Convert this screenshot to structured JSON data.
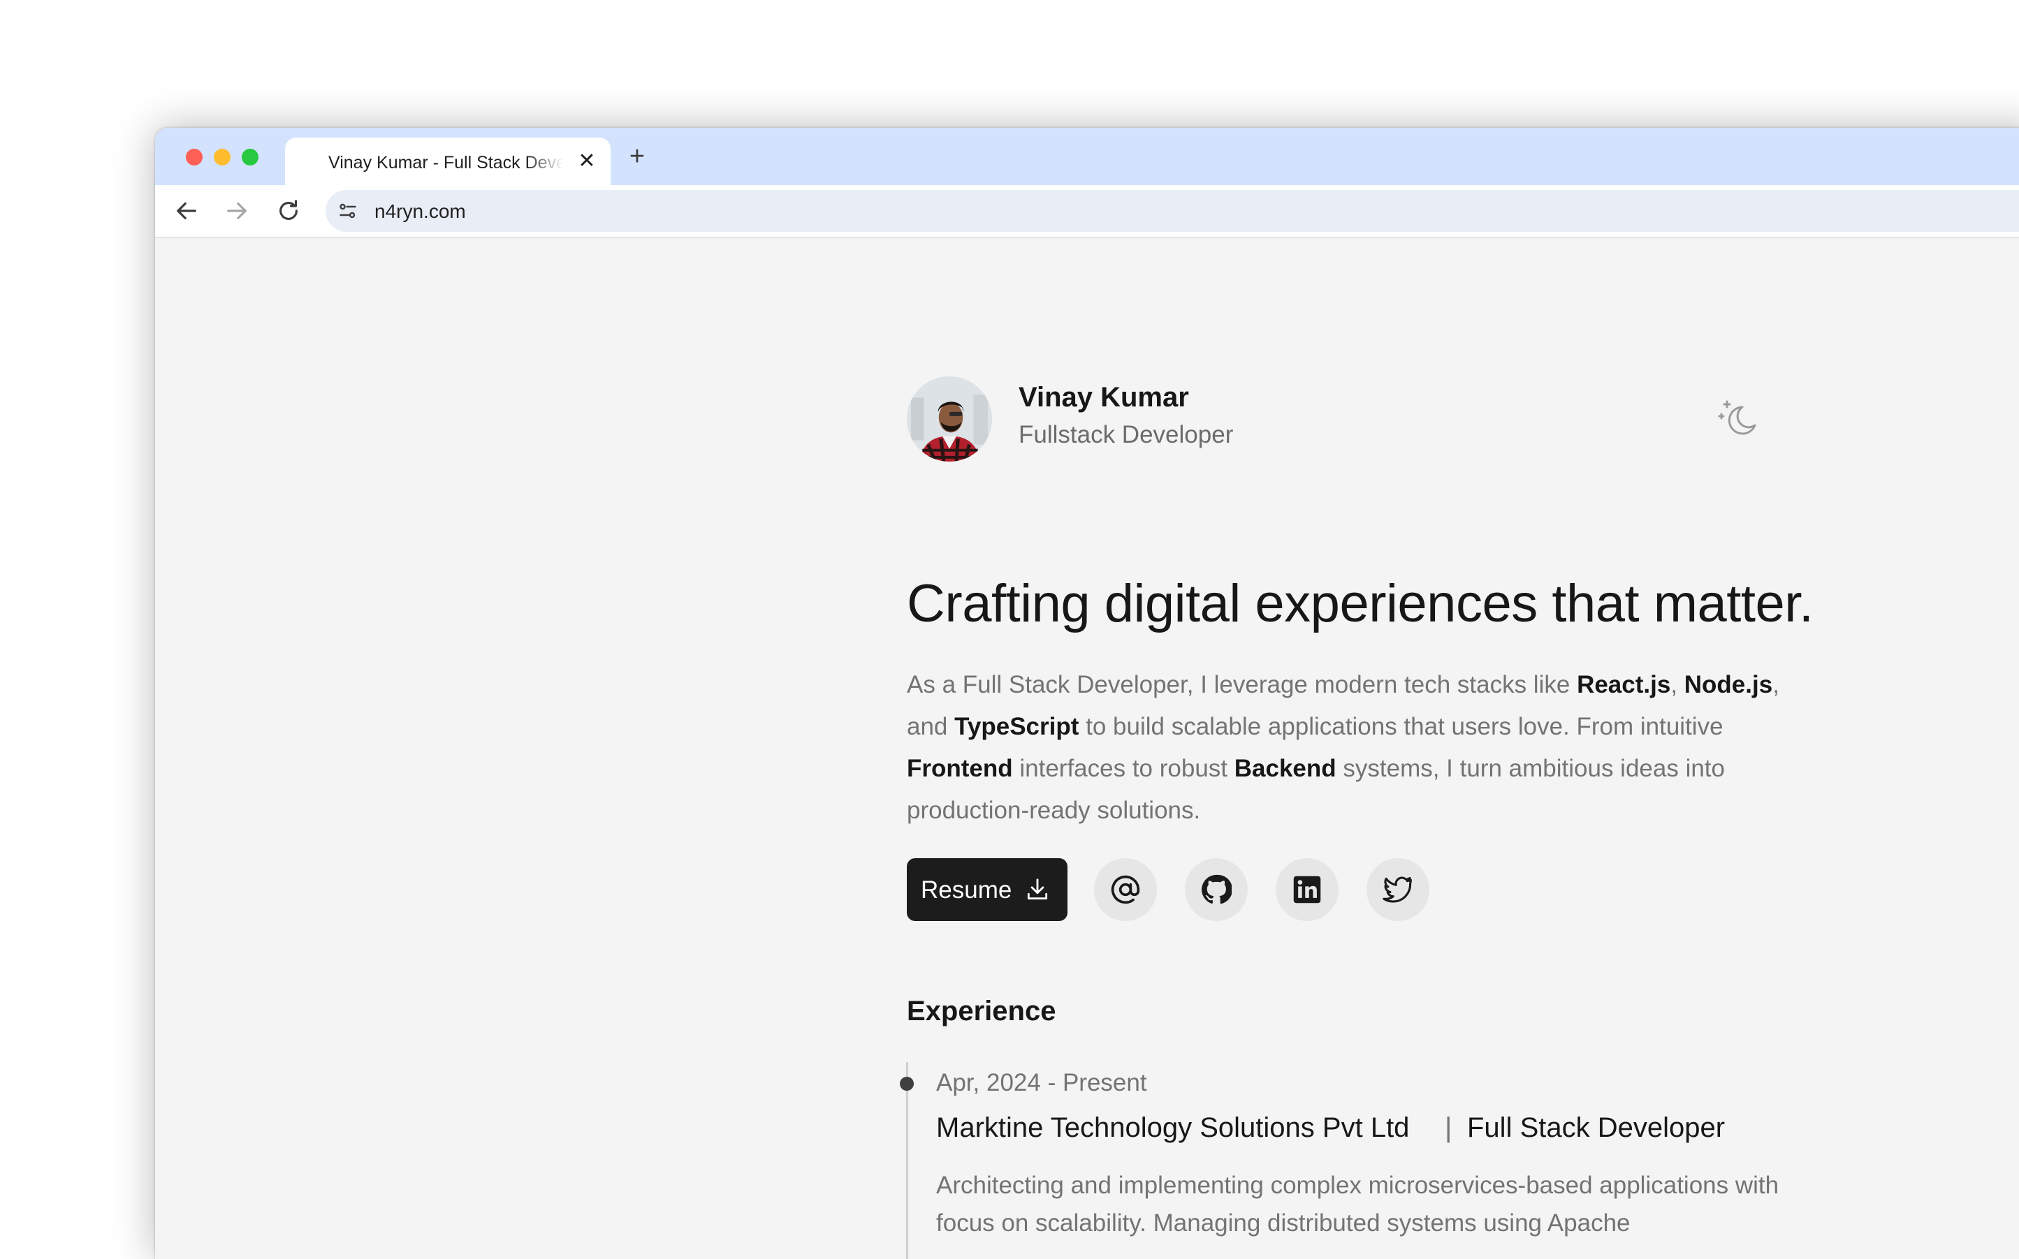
{
  "browser": {
    "tab_title": "Vinay Kumar - Full Stack Developer",
    "tab_close": "✕",
    "new_tab": "+",
    "url": "n4ryn.com"
  },
  "profile": {
    "name": "Vinay Kumar",
    "role": "Fullstack Developer"
  },
  "hero": {
    "headline": "Crafting digital experiences that matter.",
    "bio": {
      "t1": "As a Full Stack Developer, I leverage modern tech stacks like ",
      "b1": "React.js",
      "t2": ", ",
      "b2": "Node.js",
      "t3": ", and ",
      "b3": "TypeScript",
      "t4": " to build scalable applications that users love. From intuitive ",
      "b4": "Frontend",
      "t5": " interfaces to robust ",
      "b5": "Backend",
      "t6": " systems, I turn ambitious ideas into production-ready solutions."
    },
    "resume_label": "Resume",
    "socials": [
      "email",
      "github",
      "linkedin",
      "twitter"
    ]
  },
  "experience": {
    "title": "Experience",
    "items": [
      {
        "date": "Apr, 2024 - Present",
        "company": "Marktine Technology Solutions Pvt Ltd",
        "separator": "|",
        "role": "Full Stack Developer",
        "description": "Architecting and implementing complex microservices-based applications with focus on scalability. Managing distributed systems using Apache"
      }
    ]
  },
  "colors": {
    "tab_strip": "#d3e3fd",
    "page_bg": "#f4f4f4",
    "primary_button": "#1c1c1c",
    "social_button": "#e6e6e6"
  }
}
